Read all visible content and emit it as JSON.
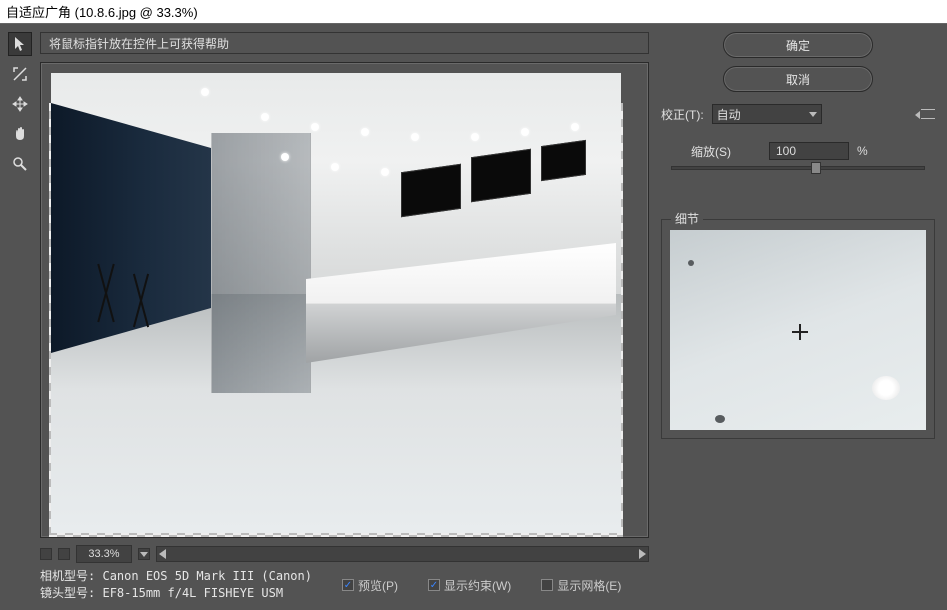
{
  "window": {
    "title": "自适应广角 (10.8.6.jpg @ 33.3%)"
  },
  "hint": "将鼠标指针放在控件上可获得帮助",
  "zoom": {
    "value": "33.3%"
  },
  "camera": {
    "model_label": "相机型号:",
    "model_value": "Canon EOS 5D Mark III (Canon)",
    "lens_label": "镜头型号:",
    "lens_value": "EF8-15mm f/4L FISHEYE USM"
  },
  "checkboxes": {
    "preview": {
      "label": "预览(P)",
      "checked": true
    },
    "constraints": {
      "label": "显示约束(W)",
      "checked": true
    },
    "grid": {
      "label": "显示网格(E)",
      "checked": false
    }
  },
  "buttons": {
    "ok": "确定",
    "cancel": "取消"
  },
  "correction": {
    "label": "校正(T):",
    "value": "自动"
  },
  "scale": {
    "label": "缩放(S)",
    "value": "100",
    "unit": "%"
  },
  "detail": {
    "title": "细节"
  },
  "tools": {
    "move": "move-tool",
    "hand": "hand-tool",
    "zoom": "zoom-tool",
    "pointer": "pointer-tool",
    "constraint": "constraint-tool"
  }
}
